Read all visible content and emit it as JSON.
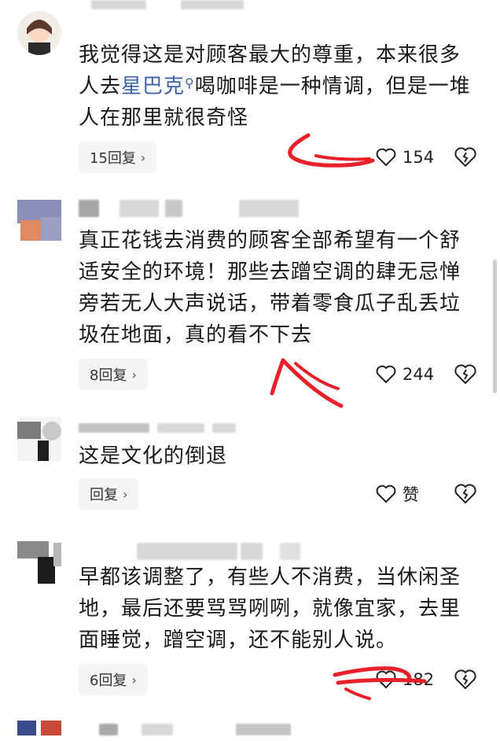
{
  "comments": [
    {
      "text_before": "我觉得这是对顾客最大的尊重，本来很多人去",
      "link_text": "星巴克",
      "text_after": "喝咖啡是一种情调，但是一堆人在那里就很奇怪",
      "reply_label": "15回复",
      "likes": "154"
    },
    {
      "text": "真正花钱去消费的顾客全部希望有一个舒适安全的环境！那些去蹭空调的肆无忌惮旁若无人大声说话，带着零食瓜子乱丢垃圾在地面，真的看不下去",
      "reply_label": "8回复",
      "likes": "244"
    },
    {
      "text": "这是文化的倒退",
      "reply_label": "回复",
      "likes": "赞"
    },
    {
      "text": "早都该调整了，有些人不消费，当休闲圣地，最后还要骂骂咧咧，就像宜家，去里面睡觉，蹭空调，还不能别人说。",
      "reply_label": "6回复",
      "likes": "182"
    }
  ],
  "icons": {
    "like": "heart-outline-icon",
    "dislike": "broken-heart-icon",
    "reply_chevron": "chevron-right-icon",
    "search_mark": "search-icon"
  },
  "colors": {
    "link": "#3b62a9",
    "reply_bg": "#f4f4f5",
    "annotation": "#e8202a"
  }
}
